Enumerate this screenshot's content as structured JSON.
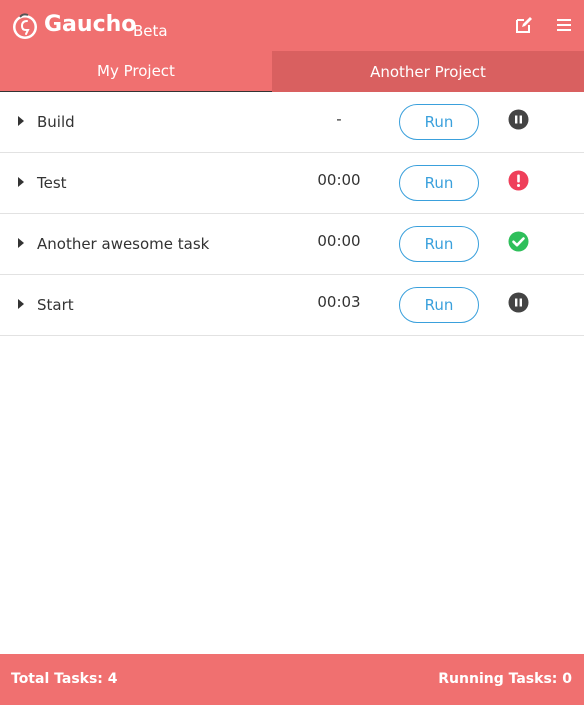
{
  "colors": {
    "accent": "#f07070",
    "tab_inactive": "#d96060",
    "run_blue": "#3aa0dc",
    "status_paused": "#444444",
    "status_error": "#ef3f5a",
    "status_success": "#2fbf5b"
  },
  "header": {
    "app_name": "Gaucho",
    "tag": "Beta",
    "logo_icon": "gaucho-logo-icon",
    "edit_icon": "edit-icon",
    "menu_icon": "hamburger-menu-icon"
  },
  "tabs": [
    {
      "label": "My Project",
      "active": true
    },
    {
      "label": "Another Project",
      "active": false
    }
  ],
  "tasks": [
    {
      "name": "Build",
      "time": "-",
      "run_label": "Run",
      "status": "paused",
      "status_icon": "pause-circle-icon"
    },
    {
      "name": "Test",
      "time": "00:00",
      "run_label": "Run",
      "status": "error",
      "status_icon": "exclamation-circle-icon"
    },
    {
      "name": "Another awesome task",
      "time": "00:00",
      "run_label": "Run",
      "status": "success",
      "status_icon": "check-circle-icon"
    },
    {
      "name": "Start",
      "time": "00:03",
      "run_label": "Run",
      "status": "paused",
      "status_icon": "pause-circle-icon"
    }
  ],
  "footer": {
    "total_label": "Total Tasks:",
    "total_value": "4",
    "running_label": "Running Tasks:",
    "running_value": "0"
  }
}
